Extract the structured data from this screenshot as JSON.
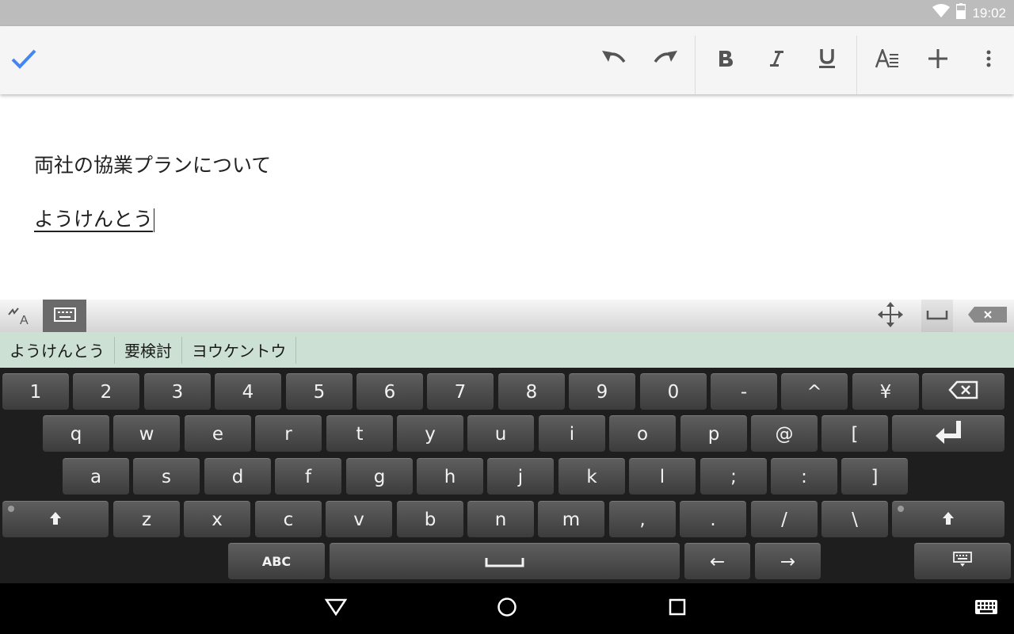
{
  "status_bar": {
    "time": "19:02",
    "icons": [
      "wifi-icon",
      "battery-icon"
    ]
  },
  "toolbar": {
    "done_icon": "check-icon",
    "actions": [
      "undo-icon",
      "redo-icon",
      "bold-icon",
      "italic-icon",
      "underline-icon",
      "text-format-icon",
      "add-icon",
      "overflow-menu-icon"
    ],
    "accent_color": "#4285f4"
  },
  "document": {
    "lines": [
      "両社の協業プランについて",
      "ようけんとう"
    ]
  },
  "ime_bar": {
    "left_icons": [
      "handwriting-icon",
      "keyboard-icon"
    ],
    "right_icons": [
      "move-icon",
      "space-icon",
      "close-keyboard-icon"
    ]
  },
  "candidates": [
    "ようけんとう",
    "要検討",
    "ヨウケントウ"
  ],
  "keyboard": {
    "rows": [
      [
        "1",
        "2",
        "3",
        "4",
        "5",
        "6",
        "7",
        "8",
        "9",
        "0",
        "-",
        "^",
        "¥"
      ],
      [
        "q",
        "w",
        "e",
        "r",
        "t",
        "y",
        "u",
        "i",
        "o",
        "p",
        "@",
        "["
      ],
      [
        "a",
        "s",
        "d",
        "f",
        "g",
        "h",
        "j",
        "k",
        "l",
        ";",
        ":",
        "]"
      ],
      [
        "z",
        "x",
        "c",
        "v",
        "b",
        "n",
        "m",
        ",",
        ".",
        "/",
        "\\"
      ]
    ],
    "abc_label": "ABC",
    "arrow_left": "←",
    "arrow_right": "→",
    "special_keys": [
      "backspace-icon",
      "enter-icon",
      "shift-icon",
      "space-icon",
      "hide-keyboard-icon"
    ]
  },
  "nav_bar": {
    "buttons": [
      "back-icon",
      "home-icon",
      "recents-icon",
      "keyboard-switch-icon"
    ]
  }
}
